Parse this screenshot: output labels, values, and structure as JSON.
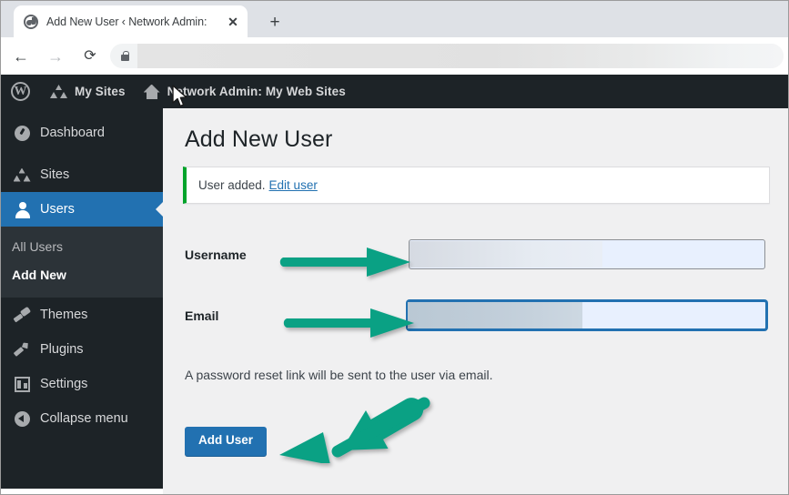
{
  "browser": {
    "tab": {
      "title": "Add New User ‹ Network Admin:",
      "favicon_name": "globe-favicon",
      "close_label": "✕"
    },
    "new_tab_label": "+",
    "nav": {
      "back_label": "←",
      "forward_label": "→",
      "reload_label": "⟳"
    },
    "omnibox": {
      "lock_icon": "lock-icon",
      "url_value": "",
      "url_redacted": true
    }
  },
  "adminbar": {
    "wp_logo_glyph": "W",
    "items": [
      {
        "label": "My Sites",
        "icon": "network-icon"
      },
      {
        "label": "Network Admin: My Web Sites",
        "icon": "home-icon"
      }
    ]
  },
  "sidebar": {
    "items": [
      {
        "label": "Dashboard",
        "icon": "dashboard-icon",
        "current": false
      },
      {
        "label": "Sites",
        "icon": "sites-icon",
        "current": false
      },
      {
        "label": "Users",
        "icon": "users-icon",
        "current": true
      },
      {
        "label": "Themes",
        "icon": "themes-icon",
        "current": false
      },
      {
        "label": "Plugins",
        "icon": "plugins-icon",
        "current": false
      },
      {
        "label": "Settings",
        "icon": "settings-icon",
        "current": false
      },
      {
        "label": "Collapse menu",
        "icon": "collapse-icon",
        "current": false
      }
    ],
    "submenu": [
      {
        "label": "All Users",
        "active": false
      },
      {
        "label": "Add New",
        "active": true
      }
    ]
  },
  "main": {
    "page_title": "Add New User",
    "notice": {
      "text": "User added.",
      "link_label": "Edit user",
      "accent_color": "#00a32a"
    },
    "fields": [
      {
        "label": "Username",
        "value": "",
        "redacted": true,
        "focused": false
      },
      {
        "label": "Email",
        "value": "",
        "redacted": true,
        "focused": true
      }
    ],
    "helper_text": "A password reset link will be sent to the user via email.",
    "submit_label": "Add User"
  },
  "annotations": {
    "arrow_color": "#0aa184",
    "arrows": [
      {
        "name": "arrow-to-username-field",
        "target": "Username"
      },
      {
        "name": "arrow-to-email-field",
        "target": "Email"
      },
      {
        "name": "arrow-to-add-user-button",
        "target": "Add User"
      }
    ]
  },
  "theme": {
    "admin_blue": "#2271b1",
    "admin_dark": "#1d2327",
    "submenu_dark": "#2c3338",
    "content_bg": "#f0f0f1"
  }
}
